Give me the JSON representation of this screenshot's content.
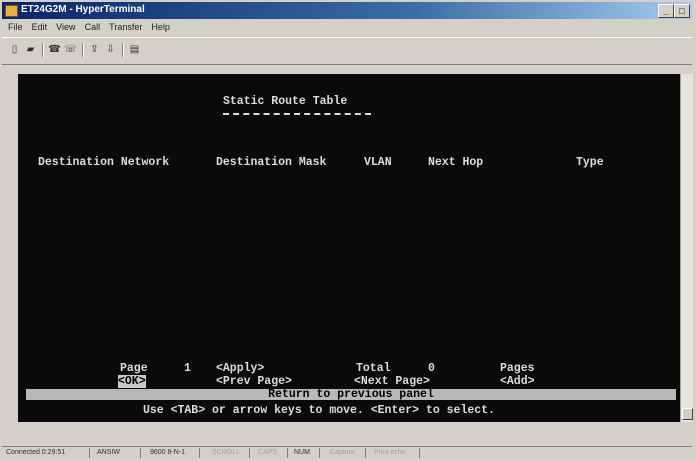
{
  "window": {
    "title": "ET24G2M - HyperTerminal"
  },
  "menu": [
    "File",
    "Edit",
    "View",
    "Call",
    "Transfer",
    "Help"
  ],
  "toolbar": [
    "new-icon",
    "open-icon",
    "phone-icon",
    "disconnect-icon",
    "send-icon",
    "receive-icon",
    "properties-icon"
  ],
  "terminal": {
    "heading": "Static Route Table",
    "columns": {
      "dest_network": "Destination Network",
      "dest_mask": "Destination Mask",
      "vlan": "VLAN",
      "next_hop": "Next Hop",
      "type": "Type"
    },
    "page_label": "Page",
    "page_number": "1",
    "apply": "<Apply>",
    "total_label": "Total",
    "total_value": "0",
    "pages_label": "Pages",
    "ok": "<OK>",
    "prev_page": "<Prev Page>",
    "next_page": "<Next Page>",
    "add": "<Add>",
    "return_msg": "Return to previous panel",
    "help_msg": "Use <TAB> or arrow keys to move. <Enter> to select."
  },
  "status": {
    "connected": "Connected 0:29:51",
    "emulation": "ANSIW",
    "settings": "9600 8-N-1",
    "scroll": "SCROLL",
    "caps": "CAPS",
    "num": "NUM",
    "capture": "Capture",
    "print_echo": "Print echo"
  }
}
